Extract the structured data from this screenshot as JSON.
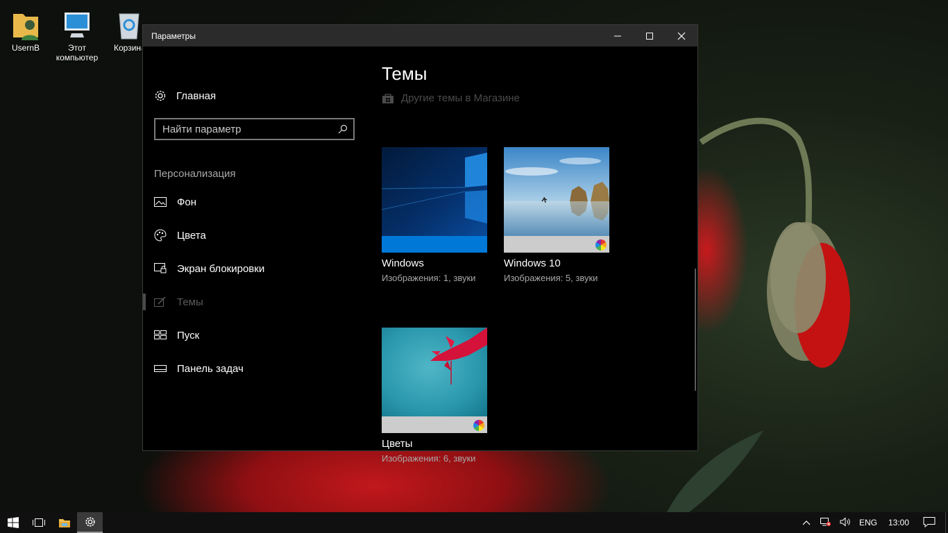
{
  "desktop": {
    "icons": [
      {
        "label": "UsernB",
        "icon": "user-folder-icon"
      },
      {
        "label": "Этот компьютер",
        "icon": "this-pc-icon"
      },
      {
        "label": "Корзина",
        "icon": "recycle-bin-icon"
      }
    ]
  },
  "window": {
    "title": "Параметры",
    "controls": {
      "minimize": "minimize-icon",
      "maximize": "maximize-icon",
      "close": "close-icon"
    }
  },
  "nav": {
    "home_label": "Главная",
    "search_placeholder": "Найти параметр",
    "section_label": "Персонализация",
    "items": [
      {
        "label": "Фон",
        "icon": "picture-icon"
      },
      {
        "label": "Цвета",
        "icon": "palette-icon"
      },
      {
        "label": "Экран блокировки",
        "icon": "lock-screen-icon"
      },
      {
        "label": "Темы",
        "icon": "themes-icon",
        "active": true
      },
      {
        "label": "Пуск",
        "icon": "start-icon"
      },
      {
        "label": "Панель задач",
        "icon": "taskbar-icon"
      }
    ]
  },
  "main": {
    "title": "Темы",
    "store_link": "Другие темы в Магазине",
    "themes": [
      {
        "name": "Windows",
        "desc": "Изображения: 1, звуки",
        "strip_color": "#0078d7"
      },
      {
        "name": "Windows 10",
        "desc": "Изображения: 5, звуки",
        "strip_color": "#cccccc"
      },
      {
        "name": "Цветы",
        "desc": "Изображения: 6, звуки",
        "strip_color": "#cccccc"
      }
    ]
  },
  "taskbar": {
    "language": "ENG",
    "time": "13:00",
    "items": [
      "start-icon",
      "task-view-icon",
      "file-explorer-icon",
      "settings-icon"
    ]
  },
  "colors": {
    "accent": "#0078d7",
    "window_bg": "#000000",
    "titlebar_bg": "#2b2b2b"
  }
}
